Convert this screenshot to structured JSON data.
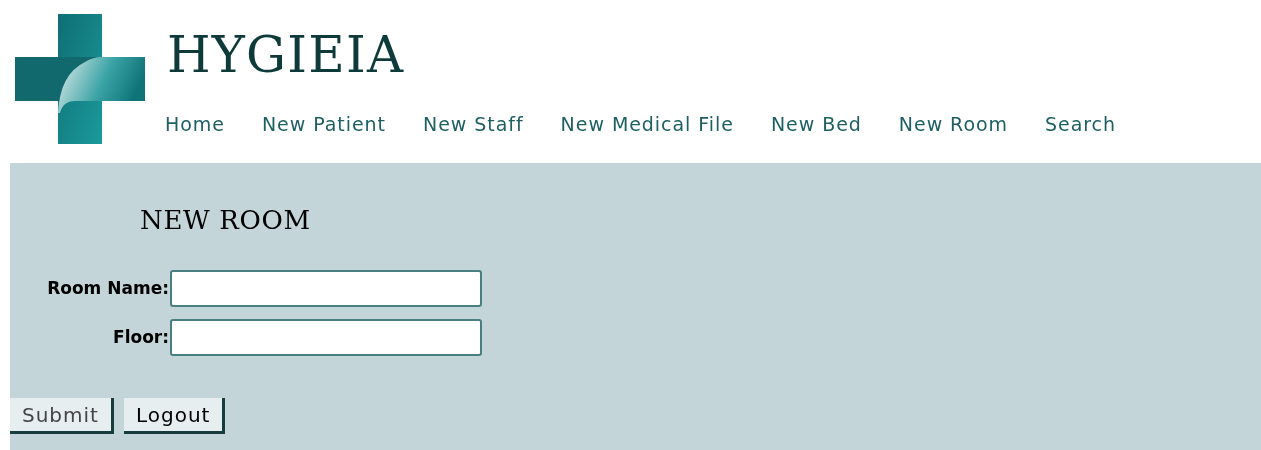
{
  "header": {
    "title": "HYGIEIA"
  },
  "nav": [
    "Home",
    "New Patient",
    "New Staff",
    "New Medical File",
    "New Bed",
    "New Room",
    "Search"
  ],
  "form": {
    "heading": "NEW ROOM",
    "fields": [
      {
        "label": "Room Name:"
      },
      {
        "label": "Floor:"
      }
    ],
    "buttons": [
      "Submit",
      "Logout"
    ]
  }
}
